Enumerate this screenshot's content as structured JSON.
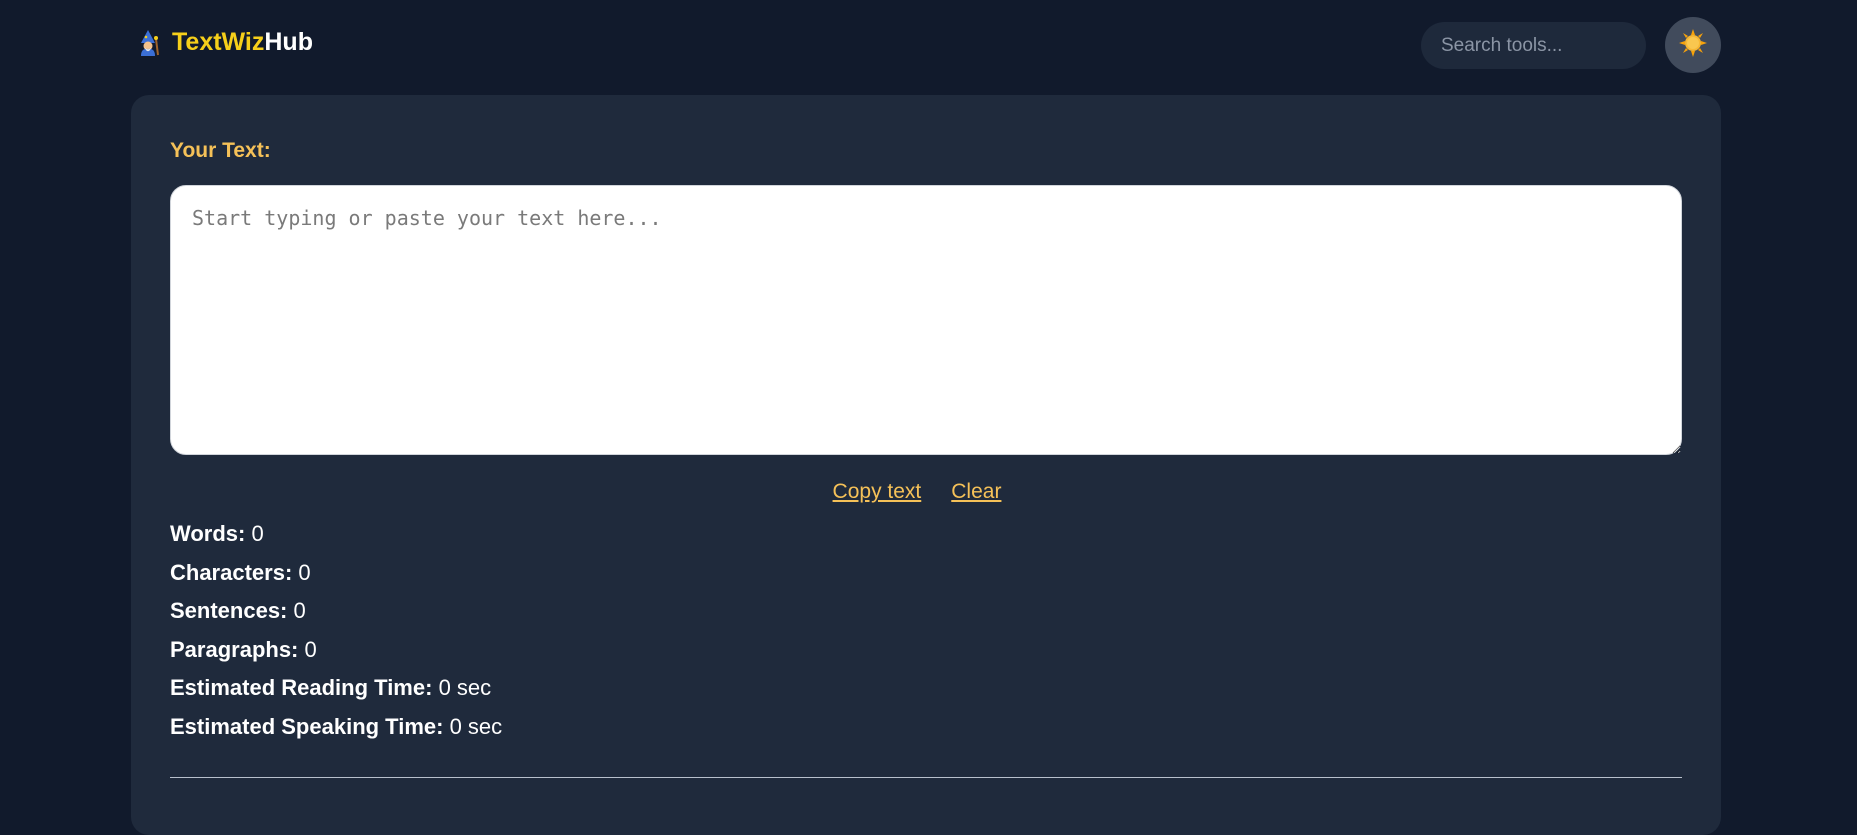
{
  "header": {
    "brand_part1": "TextWiz",
    "brand_part2": "Hub",
    "logo_icon": "wizard-icon",
    "search_placeholder": "Search tools...",
    "theme_toggle_icon": "sun-icon"
  },
  "editor": {
    "label": "Your Text:",
    "placeholder": "Start typing or paste your text here...",
    "value": ""
  },
  "actions": {
    "copy_label": "Copy text",
    "clear_label": "Clear"
  },
  "stats": [
    {
      "label": "Words:",
      "value": "0"
    },
    {
      "label": "Characters:",
      "value": "0"
    },
    {
      "label": "Sentences:",
      "value": "0"
    },
    {
      "label": "Paragraphs:",
      "value": "0"
    },
    {
      "label": "Estimated Reading Time:",
      "value": "0 sec"
    },
    {
      "label": "Estimated Speaking Time:",
      "value": "0 sec"
    }
  ],
  "colors": {
    "background": "#111a2c",
    "card": "#1f2a3c",
    "accent": "#f5c158",
    "brand_yellow": "#f6cf1a"
  }
}
